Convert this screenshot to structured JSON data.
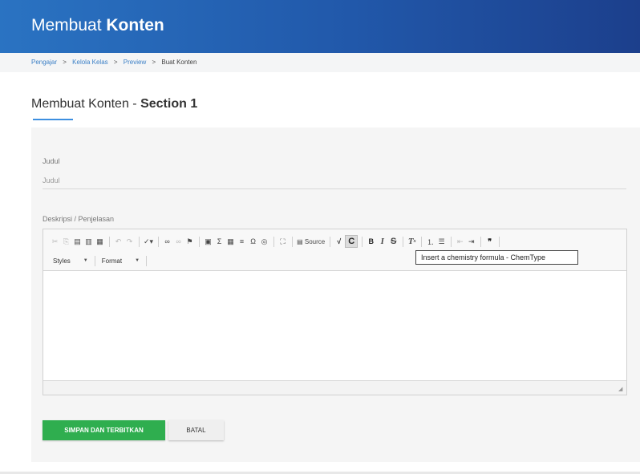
{
  "header": {
    "title_prefix": "Membuat",
    "title_bold": "Konten"
  },
  "breadcrumb": {
    "items": [
      "Pengajar",
      "Kelola Kelas",
      "Preview",
      "Buat Konten"
    ],
    "separator": ">"
  },
  "section": {
    "title_prefix": "Membuat Konten - ",
    "title_bold": "Section 1"
  },
  "form": {
    "judul_label": "Judul",
    "judul_placeholder": "Judul",
    "judul_value": "",
    "desc_label": "Deskripsi / Penjelasan"
  },
  "editor": {
    "toolbar_icons": [
      "cut-icon",
      "copy-icon",
      "paste-icon",
      "paste-text-icon",
      "paste-word-icon",
      "undo-icon",
      "redo-icon",
      "spellcheck-icon",
      "link-icon",
      "unlink-icon",
      "anchor-icon",
      "image-icon",
      "sigma-icon",
      "table-icon",
      "horizontal-line-icon",
      "omega-icon",
      "iframe-icon",
      "maximize-icon",
      "source-icon",
      "math-formula-icon",
      "chemistry-formula-icon",
      "bold-icon",
      "italic-icon",
      "strikethrough-icon",
      "remove-format-icon",
      "numbered-list-icon",
      "bulleted-list-icon",
      "outdent-icon",
      "indent-icon",
      "blockquote-icon"
    ],
    "source_label": "Source",
    "bold_label": "B",
    "italic_label": "I",
    "strike_label": "S",
    "chem_label": "C",
    "styles_label": "Styles",
    "format_label": "Format",
    "tooltip": "Insert a chemistry formula - ChemType"
  },
  "buttons": {
    "save": "SIMPAN DAN TERBITKAN",
    "cancel": "BATAL"
  },
  "colors": {
    "header": "#2158aa",
    "accent": "#3d8fe0",
    "save_button": "#2fae4f",
    "link": "#3a7fc6"
  }
}
